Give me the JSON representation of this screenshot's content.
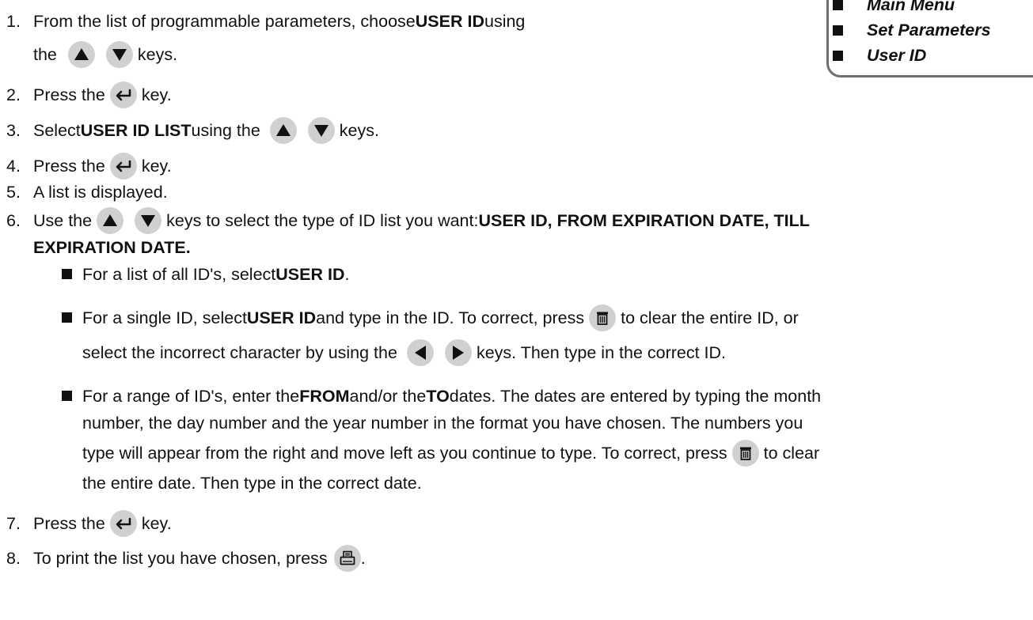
{
  "sidebar": {
    "items": [
      "Main Menu",
      "Set Parameters",
      "User ID"
    ]
  },
  "steps": {
    "s1": {
      "num": "1.",
      "a": "From the list of programmable parameters, choose ",
      "b": "USER ID",
      "c": " using",
      "d": "the",
      "e": "keys."
    },
    "s2": {
      "num": "2.",
      "a": "Press the",
      "b": "key."
    },
    "s3": {
      "num": "3.",
      "a": "Select ",
      "b": "USER ID LIST",
      "c": " using the",
      "d": "keys."
    },
    "s4": {
      "num": "4.",
      "a": "Press the",
      "b": "key."
    },
    "s5": {
      "num": "5.",
      "a": "A list is displayed."
    },
    "s6": {
      "num": "6.",
      "a": "Use the",
      "b": "keys to select the type of ID list you want: ",
      "c": "USER ID, FROM EXPIRATION DATE, TILL",
      "d": "EXPIRATION DATE."
    },
    "b1": {
      "a": "For a list of all ID's, select ",
      "b": "USER ID",
      "c": "."
    },
    "b2": {
      "a": "For a single ID, select ",
      "b": "USER ID",
      "c": " and type in the ID.  To correct, press",
      "d": "to clear the entire ID, or",
      "e": "select the incorrect character by using the",
      "f": "keys. Then type in the correct ID."
    },
    "b3": {
      "a": "For a range of ID's, enter the ",
      "b": "FROM",
      "c": " and/or the ",
      "d": "TO",
      "e": " dates. The dates are entered by typing the month",
      "f": "number, the day number and the year number in the format you have chosen.  The numbers you",
      "g": "type will appear from the right and move left as you continue to type.  To correct, press",
      "h": "to clear",
      "i": "the entire date. Then type in the correct date."
    },
    "s7": {
      "num": "7.",
      "a": "Press the",
      "b": "key."
    },
    "s8": {
      "num": "8.",
      "a": "To print the list you have chosen, press",
      "b": "."
    }
  },
  "icons": {
    "up": "up-arrow-key-icon",
    "down": "down-arrow-key-icon",
    "left": "left-arrow-key-icon",
    "right": "right-arrow-key-icon",
    "enter": "enter-key-icon",
    "clear": "trash-clear-key-icon",
    "print": "print-key-icon"
  },
  "colors": {
    "key_bg": "#d0d0d0",
    "text": "#111111",
    "box_border": "#6e6e6e"
  }
}
